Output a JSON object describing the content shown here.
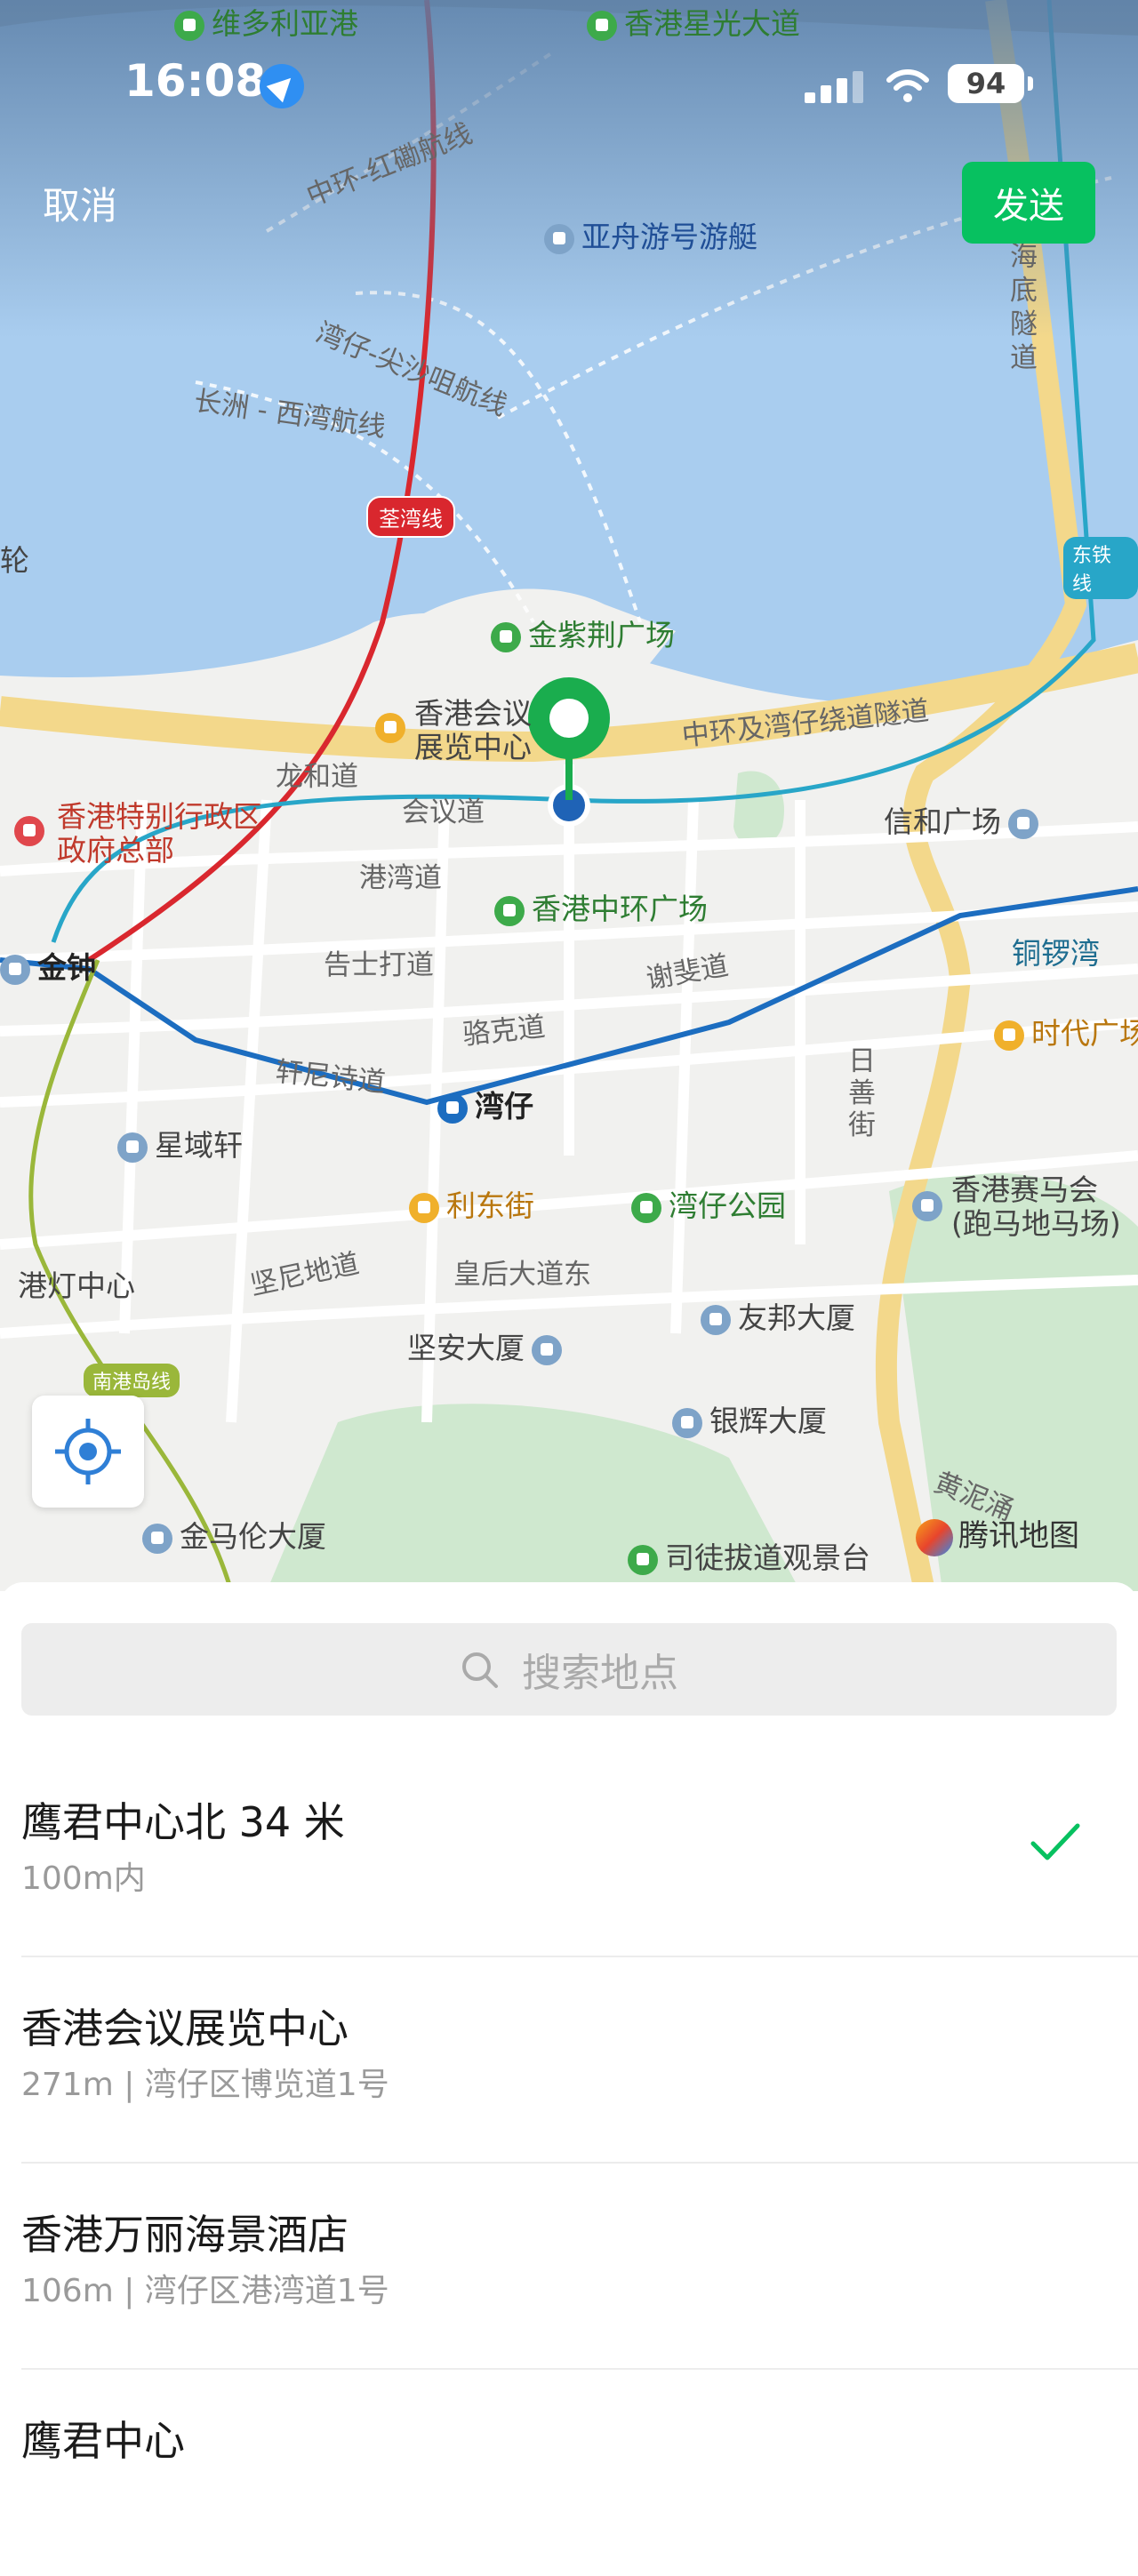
{
  "status_bar": {
    "time": "16:08",
    "battery": "94"
  },
  "header": {
    "cancel_label": "取消",
    "send_label": "发送"
  },
  "map": {
    "labels": {
      "victoria_harbour": "维多利亚港",
      "avenue_of_stars": "香港星光大道",
      "ferry_line_1": "中环-红磡航线",
      "yacht": "亚舟游号游艇",
      "ferry_line_2": "湾仔-尖沙咀航线",
      "ferry_line_3": "长洲 - 西湾航线",
      "tsuen_wan_line": "荃湾线",
      "tunnel": "海底隧道",
      "east_rail": "东铁线",
      "ferry_edge": "轮",
      "bauhinia_square": "金紫荆广场",
      "convention_centre": "香港会议展览中心",
      "bypass": "中环及湾仔绕道隧道",
      "lung_wo_road": "龙和道",
      "convention_avenue": "会议道",
      "hksar_hq": "香港特别行政区政府总部",
      "shun_wo_plaza": "信和广场",
      "harbour_road": "港湾道",
      "central_plaza": "香港中环广场",
      "admiralty": "金钟",
      "gloucester_road": "告士打道",
      "jaffe_road": "谢斐道",
      "causeway_bay": "铜锣湾",
      "lockhart_road": "骆克道",
      "times_square": "时代广场",
      "hennessy_road": "轩尼诗道",
      "wan_chai": "湾仔",
      "canal_road": "日善街",
      "star_crest": "星域轩",
      "lee_tung_street": "利东街",
      "wan_chai_park": "湾仔公园",
      "racecourse": "香港赛马会(跑马地马场)",
      "kennedy_road": "坚尼地道",
      "queens_road_east": "皇后大道东",
      "lighthouse": "港灯中心",
      "hopewell_centre": "友邦大厦",
      "kin_on_building": "坚安大厦",
      "south_island_line": "南港岛线",
      "silver_building": "银辉大厦",
      "wong_nai_chung": "黄泥涌",
      "kennedy_centre": "金马伦大厦",
      "lookout": "司徒拔道观景台"
    },
    "logo": "腾讯地图"
  },
  "search": {
    "placeholder": "搜索地点"
  },
  "locations": [
    {
      "name": "鹰君中心北 34 米",
      "sub": "100m内",
      "selected": true
    },
    {
      "name": "香港会议展览中心",
      "sub": "271m | 湾仔区博览道1号",
      "selected": false
    },
    {
      "name": "香港万丽海景酒店",
      "sub": "106m | 湾仔区港湾道1号",
      "selected": false
    },
    {
      "name": "鹰君中心",
      "sub": "",
      "selected": false
    }
  ],
  "colors": {
    "accent": "#07c160",
    "water": "#a9cdef",
    "land": "#f1f1ef",
    "metro_red": "#d9272e",
    "metro_blue": "#1c6dc0"
  }
}
